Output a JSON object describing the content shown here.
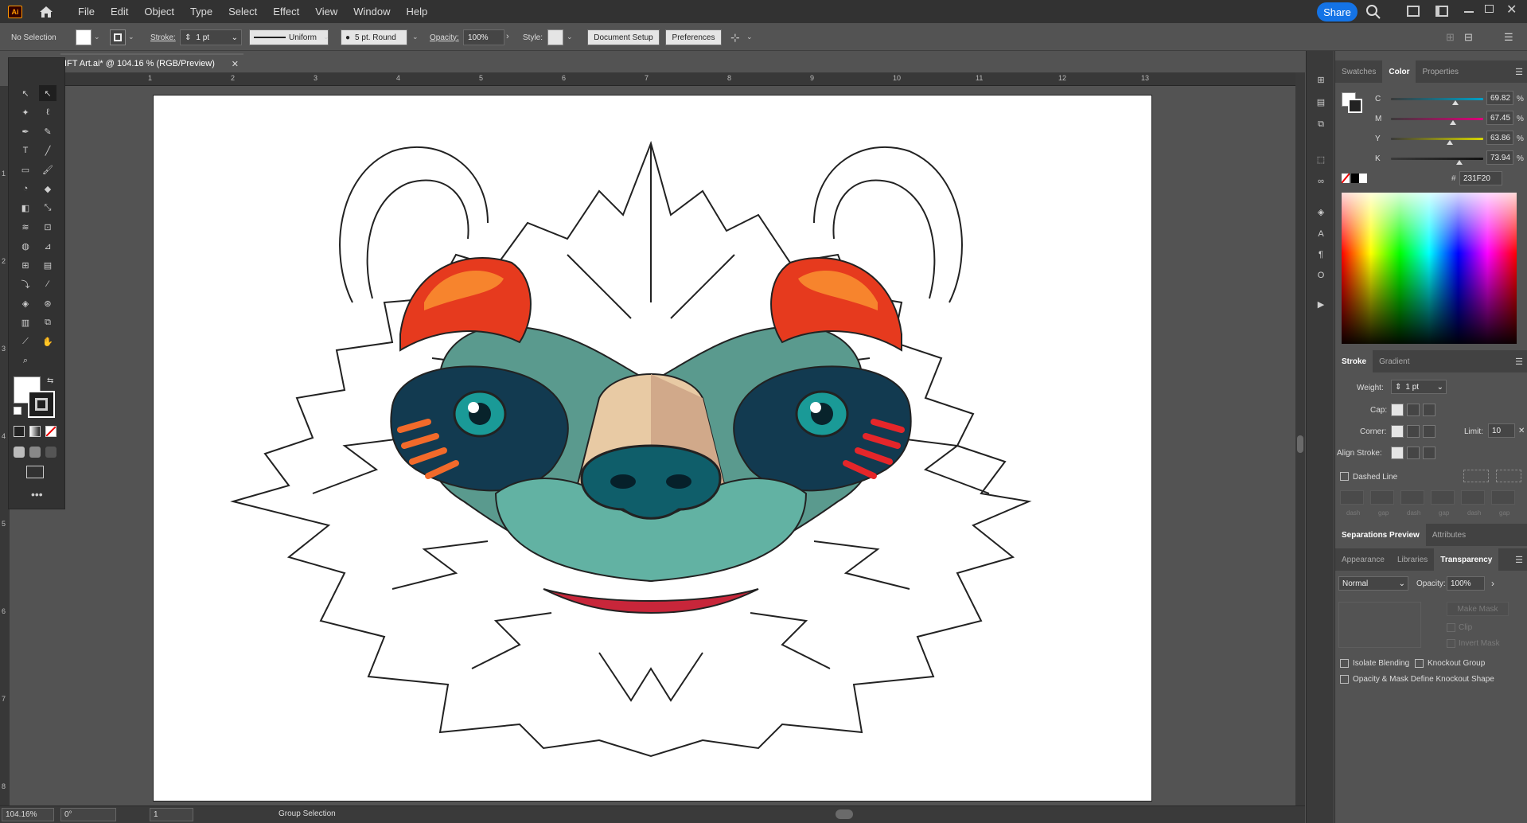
{
  "menubar": {
    "logo": "Ai",
    "items": [
      "File",
      "Edit",
      "Object",
      "Type",
      "Select",
      "Effect",
      "View",
      "Window",
      "Help"
    ],
    "share_label": "Share"
  },
  "controlbar": {
    "selection": "No Selection",
    "stroke_label": "Stroke:",
    "stroke_weight": "1 pt",
    "profile": "Uniform",
    "brush": "5 pt. Round",
    "opacity_label": "Opacity:",
    "opacity_value": "100%",
    "style_label": "Style:",
    "document_setup": "Document Setup",
    "preferences": "Preferences"
  },
  "document": {
    "tab_title": "IFT Art.ai* @ 104.16 % (RGB/Preview)"
  },
  "ruler": {
    "top": [
      "1",
      "2",
      "3",
      "4",
      "5",
      "6",
      "7",
      "8",
      "9",
      "10",
      "11",
      "12",
      "13"
    ],
    "left": [
      "1",
      "2",
      "3",
      "4",
      "5",
      "6",
      "7",
      "8"
    ]
  },
  "statusbar": {
    "zoom": "104.16%",
    "rotation": "0°",
    "artboard": "1",
    "tool": "Group Selection"
  },
  "color_panel": {
    "tabs": [
      "Swatches",
      "Color",
      "Properties"
    ],
    "channels": [
      {
        "name": "C",
        "value": "69.82",
        "unit": "%",
        "level": 0.698
      },
      {
        "name": "M",
        "value": "67.45",
        "unit": "%",
        "level": 0.675
      },
      {
        "name": "Y",
        "value": "63.86",
        "unit": "%",
        "level": 0.639
      },
      {
        "name": "K",
        "value": "73.94",
        "unit": "%",
        "level": 0.739
      }
    ],
    "hex": "231F20"
  },
  "stroke_panel": {
    "tabs": [
      "Stroke",
      "Gradient"
    ],
    "weight_label": "Weight:",
    "weight_value": "1 pt",
    "cap_label": "Cap:",
    "corner_label": "Corner:",
    "limit_label": "Limit:",
    "limit_value": "10",
    "align_label": "Align Stroke:",
    "dashed_label": "Dashed Line",
    "dash_labels": [
      "dash",
      "gap",
      "dash",
      "gap",
      "dash",
      "gap"
    ]
  },
  "sep_panel": {
    "tabs": [
      "Separations Preview",
      "Attributes"
    ]
  },
  "transparency_panel": {
    "tabs": [
      "Appearance",
      "Libraries",
      "Transparency"
    ],
    "blend_mode": "Normal",
    "opacity_label": "Opacity:",
    "opacity_value": "100%",
    "make_mask": "Make Mask",
    "clip": "Clip",
    "invert_mask": "Invert Mask",
    "isolate": "Isolate Blending",
    "knockout": "Knockout Group",
    "opacity_mask": "Opacity & Mask Define Knockout Shape"
  },
  "colors": {
    "accent": "#1473e6",
    "fill_color": "#231F20"
  }
}
